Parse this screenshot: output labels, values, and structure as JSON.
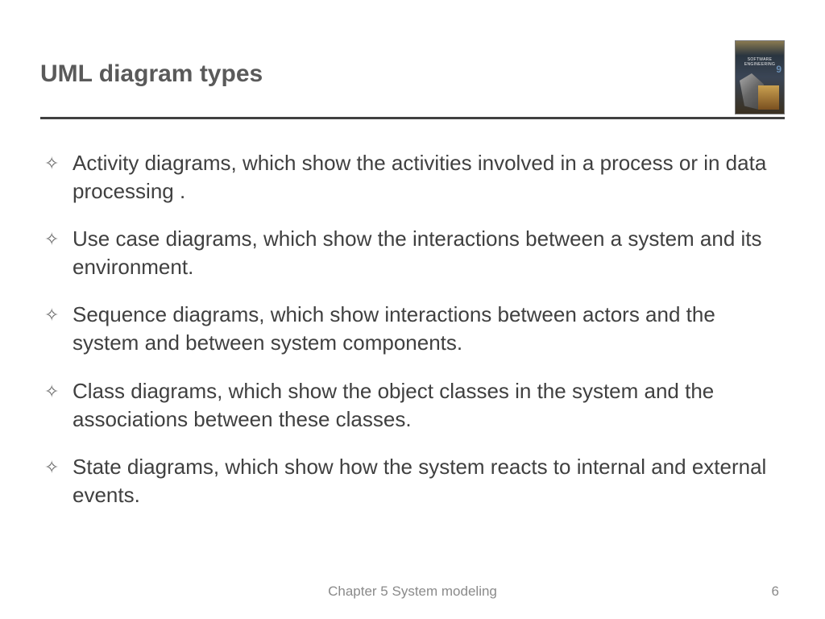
{
  "header": {
    "title": "UML diagram types",
    "book_label": "Software Engineering 9"
  },
  "bullets": [
    {
      "marker": "✧",
      "text": "Activity diagrams, which show the activities involved in a process or in data processing ."
    },
    {
      "marker": "✧",
      "text": "Use case diagrams, which show the interactions between a system and its environment."
    },
    {
      "marker": "✧",
      "text": "Sequence diagrams, which show interactions between actors and the system and between system components."
    },
    {
      "marker": "✧",
      "text": "Class diagrams, which show the object classes in the system and the associations between these classes."
    },
    {
      "marker": "✧",
      "text": "State diagrams, which show how the system reacts to internal and external events."
    }
  ],
  "footer": {
    "chapter": "Chapter 5 System modeling",
    "page": "6"
  }
}
